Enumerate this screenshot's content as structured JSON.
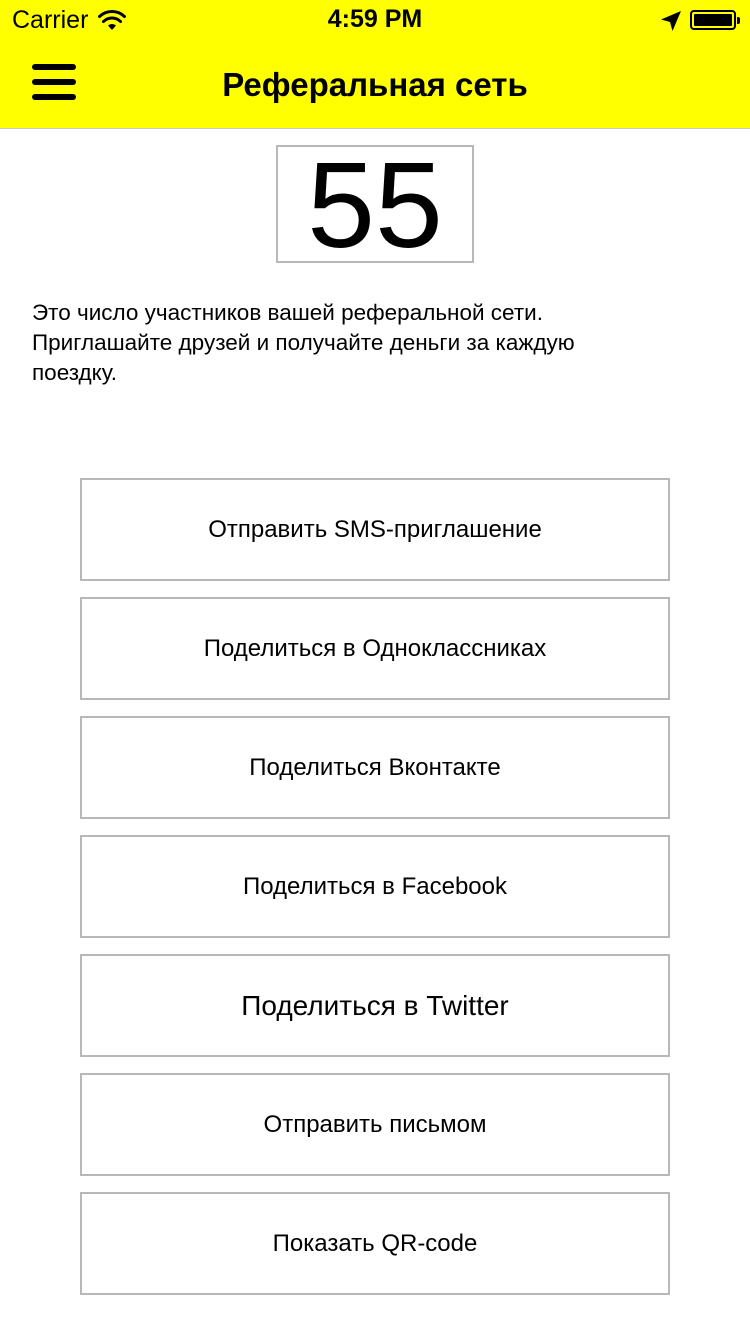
{
  "status_bar": {
    "carrier": "Carrier",
    "time": "4:59 PM",
    "wifi_icon": "wifi-icon",
    "location_icon": "location-arrow-icon",
    "battery_icon": "battery-icon",
    "battery_level": 1.0
  },
  "navbar": {
    "menu_icon": "hamburger-menu-icon",
    "title": "Реферальная сеть",
    "background_color": "#ffff00"
  },
  "counter": {
    "value": "55"
  },
  "description": {
    "line1": "Это число участников вашей реферальной сети.",
    "line2": "Приглашайте друзей и получайте деньги за каждую",
    "line3": "поездку."
  },
  "actions": {
    "sms": "Отправить SMS-приглашение",
    "odnoklassniki": "Поделиться в Одноклассниках",
    "vkontakte": "Поделиться Вконтакте",
    "facebook": "Поделиться в Facebook",
    "twitter": "Поделиться в Twitter",
    "email": "Отправить письмом",
    "qr": "Показать QR-code"
  }
}
